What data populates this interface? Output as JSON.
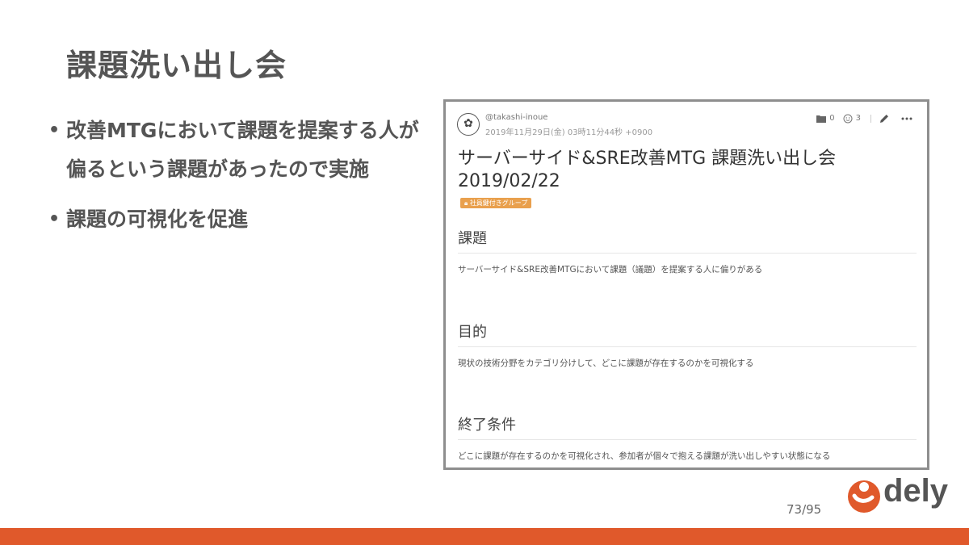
{
  "slide": {
    "title": "課題洗い出し会",
    "bullets": [
      "改善MTGにおいて課題を提案する人が偏るという課題があったので実施",
      "課題の可視化を促進"
    ],
    "page_number": "73/95",
    "accent_color": "#e0592b"
  },
  "document": {
    "author": "@takashi-inoue",
    "datetime": "2019年11月29日(金) 03時11分44秒 +0900",
    "stats": {
      "folder_count": "0",
      "like_count": "3"
    },
    "icons": [
      "folder-icon",
      "smile-icon",
      "pencil-icon",
      "more-icon"
    ],
    "title": "サーバーサイド&SRE改善MTG 課題洗い出し会 2019/02/22",
    "tag": "社員鍵付きグループ",
    "sections": [
      {
        "heading": "課題",
        "body": "サーバーサイド&SRE改善MTGにおいて課題（議題）を提案する人に偏りがある"
      },
      {
        "heading": "目的",
        "body": "現状の技術分野をカテゴリ分けして、どこに課題が存在するのかを可視化する"
      },
      {
        "heading": "終了条件",
        "body": "どこに課題が存在するのかを可視化され、参加者が個々で抱える課題が洗い出しやすい状態になる"
      }
    ]
  },
  "logo": {
    "text": "dely",
    "color": "#e0592b"
  }
}
